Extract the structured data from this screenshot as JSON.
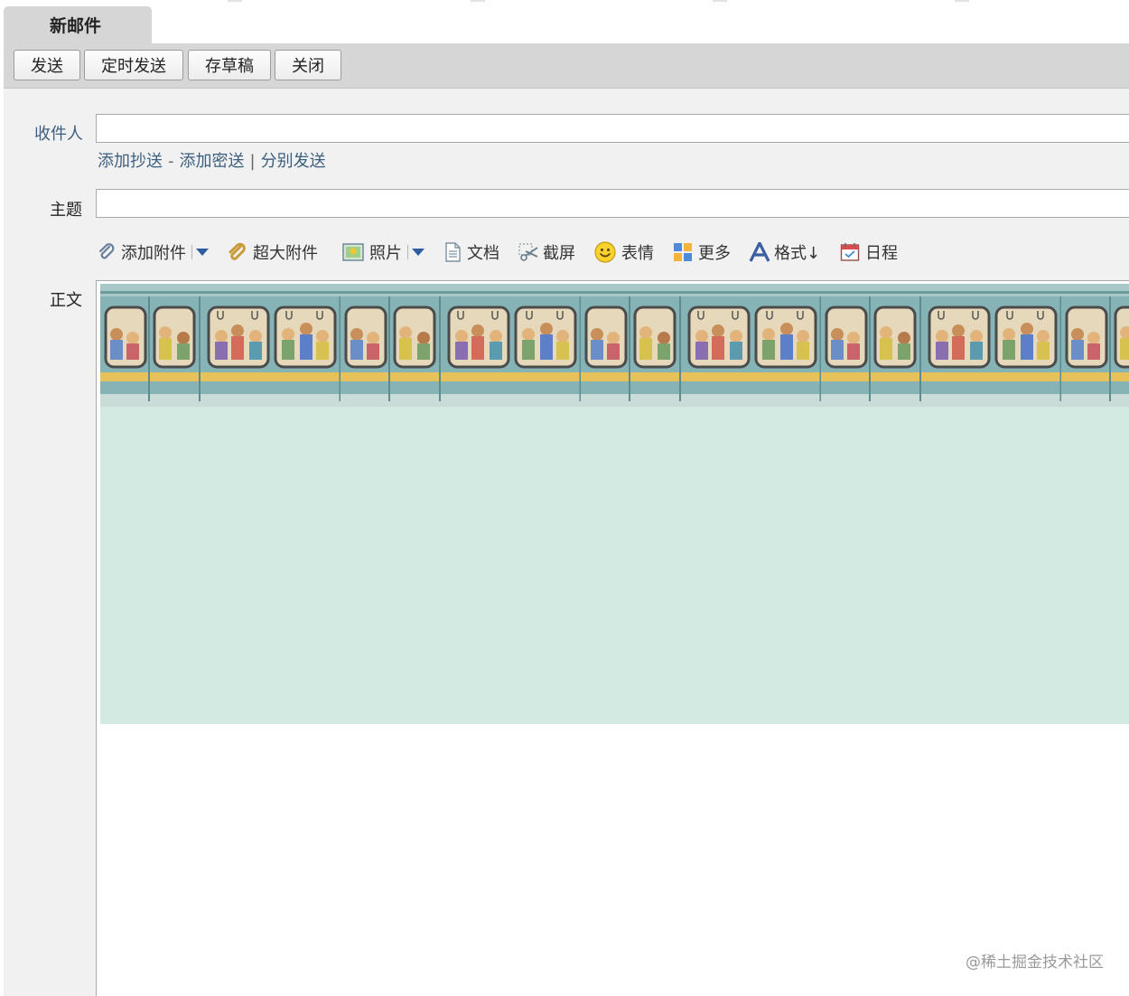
{
  "window": {
    "tab_title": "新邮件"
  },
  "toolbar": {
    "send": "发送",
    "scheduled_send": "定时发送",
    "save_draft": "存草稿",
    "close": "关闭"
  },
  "form": {
    "recipient_label": "收件人",
    "recipient_value": "",
    "add_cc": "添加抄送",
    "add_bcc": "添加密送",
    "separate_send": "分别发送",
    "dash": "-",
    "pipe": "|",
    "subject_label": "主题",
    "subject_value": "",
    "body_label": "正文"
  },
  "attachments_bar": {
    "add_attachment": "添加附件",
    "large_attachment": "超大附件",
    "photo": "照片",
    "document": "文档",
    "screenshot": "截屏",
    "emoji": "表情",
    "more": "更多",
    "format": "格式↓",
    "schedule": "日程"
  },
  "icons": {
    "attach": "paperclip-icon",
    "large_attach": "large-paperclip-icon",
    "photo": "photo-icon",
    "document": "document-icon",
    "screenshot": "scissors-icon",
    "emoji": "smiley-icon",
    "more": "grid-icon",
    "format": "font-a-icon",
    "schedule": "calendar-icon"
  },
  "colors": {
    "toolbar_bg": "#d6d6d6",
    "form_bg": "#f1f1f1",
    "link_blue": "#3d5f7f",
    "stationery_bg": "#d3eae2"
  },
  "watermark": "@稀土掘金技术社区"
}
